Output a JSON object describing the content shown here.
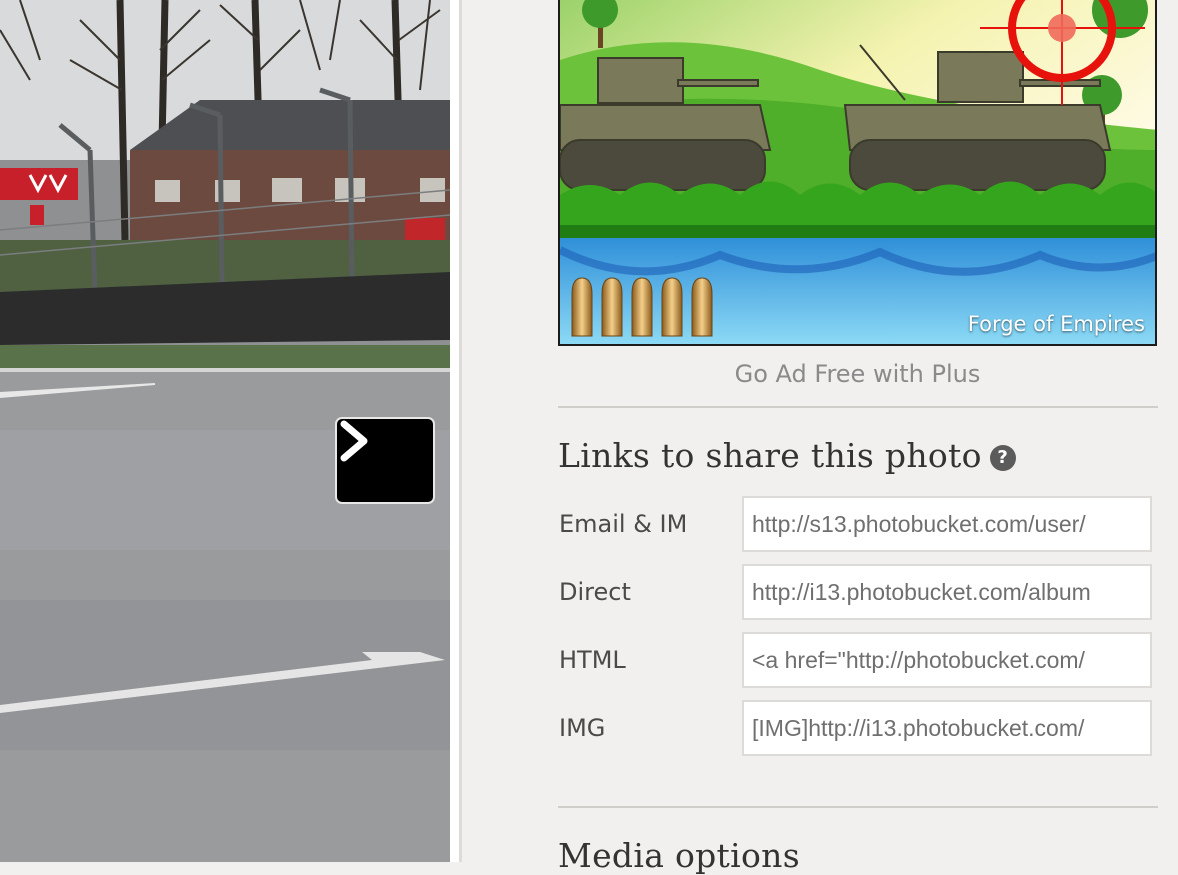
{
  "viewer": {
    "next_button_icon": "chevron-right-icon"
  },
  "ad": {
    "caption": "Forge of Empires",
    "ammo_count": 5,
    "ad_free_link": "Go Ad Free with Plus"
  },
  "share": {
    "heading": "Links to share this photo",
    "help_icon_glyph": "?",
    "links": [
      {
        "label": "Email & IM",
        "value": "http://s13.photobucket.com/user/"
      },
      {
        "label": "Direct",
        "value": "http://i13.photobucket.com/album"
      },
      {
        "label": "HTML",
        "value": "<a href=\"http://photobucket.com/"
      },
      {
        "label": "IMG",
        "value": "[IMG]http://i13.photobucket.com/"
      }
    ]
  },
  "media": {
    "heading": "Media options"
  },
  "colors": {
    "panel_bg": "#f1f0ee",
    "crosshair": "#e8120c",
    "heading_text": "#333333"
  }
}
